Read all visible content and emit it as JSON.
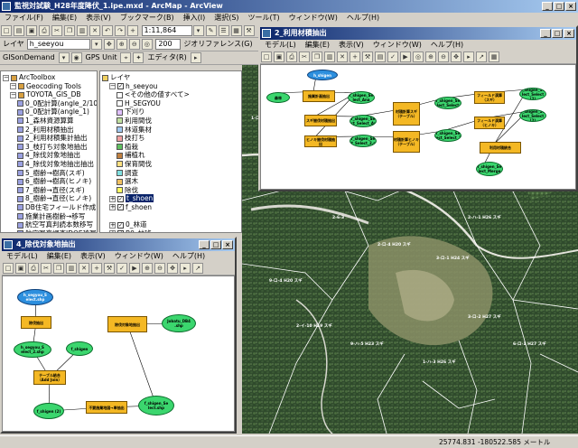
{
  "app": {
    "title": "監視対試験_H28年度降伏_1.ipe.mxd - ArcMap - ArcView"
  },
  "menu": [
    "ファイル(F)",
    "編集(E)",
    "表示(V)",
    "ブックマーク(B)",
    "挿入(I)",
    "選択(S)",
    "ツール(T)",
    "ウィンドウ(W)",
    "ヘルプ(H)"
  ],
  "toolbar1": {
    "scale_value": "1:11,864"
  },
  "toolbar2": {
    "layer_label": "レイヤ",
    "layer_value": "h_seeyou",
    "zoom_value": "200",
    "georef_label": "ジオリファレンス(G)"
  },
  "toolbar3": {
    "gisondemand": "GISonDemand",
    "gps_unit": "GPS Unit",
    "editor": "エディタ(R)"
  },
  "arctoolbox": {
    "items": [
      {
        "label": "ArcToolbox",
        "level": 0,
        "type": "root"
      },
      {
        "label": "Geocoding Tools",
        "level": 1,
        "type": "toolbox"
      },
      {
        "label": "TOYOTA_GIS_DB",
        "level": 1,
        "type": "toolbox"
      },
      {
        "label": "0_0配計算(angle_2/100)",
        "level": 2,
        "type": "tool"
      },
      {
        "label": "0_0配計算(angle_1)",
        "level": 2,
        "type": "tool"
      },
      {
        "label": "1_森林資源算算",
        "level": 2,
        "type": "tool"
      },
      {
        "label": "2_利用材積抽出",
        "level": 2,
        "type": "tool"
      },
      {
        "label": "2_利用材積集計抽出",
        "level": 2,
        "type": "tool"
      },
      {
        "label": "3_枝打ち対象地抽出",
        "level": 2,
        "type": "tool"
      },
      {
        "label": "4_除伐対象地抽出",
        "level": 2,
        "type": "tool"
      },
      {
        "label": "4_除伐対象地抽出抽出",
        "level": 2,
        "type": "tool"
      },
      {
        "label": "5_樹齢→樹高(スギ)",
        "level": 2,
        "type": "tool"
      },
      {
        "label": "6_樹齢→樹高(ヒノキ)",
        "level": 2,
        "type": "tool"
      },
      {
        "label": "7_樹齢→直径(スギ)",
        "level": 2,
        "type": "tool"
      },
      {
        "label": "8_樹齢→直径(ヒノキ)",
        "level": 2,
        "type": "tool"
      },
      {
        "label": "DB住宅フィールド作成",
        "level": 2,
        "type": "tool"
      },
      {
        "label": "施業計画樹齢→移写",
        "level": 2,
        "type": "tool"
      },
      {
        "label": "航空写真判読本数移写",
        "level": 2,
        "type": "tool"
      },
      {
        "label": "航空写真調査IDOE移写",
        "level": 2,
        "type": "tool"
      },
      {
        "label": "航空写真調査法移写",
        "level": 2,
        "type": "tool"
      },
      {
        "label": "カートグラフィ ツール",
        "level": 1,
        "type": "toolbox"
      },
      {
        "label": "サーバ ツール",
        "level": 1,
        "type": "toolbox"
      }
    ]
  },
  "toc": {
    "items": [
      {
        "label": "レイヤ",
        "level": 0,
        "type": "root"
      },
      {
        "label": "h_seeyou",
        "level": 1,
        "type": "layer",
        "checked": true
      },
      {
        "label": "<その他の値すべて>",
        "level": 2,
        "type": "legend",
        "color": "#ffffff"
      },
      {
        "label": "H_SEGYOU",
        "level": 2,
        "type": "legend",
        "color": "#ffffff"
      },
      {
        "label": "下刈り",
        "level": 2,
        "type": "legend",
        "color": "#e0c0ff"
      },
      {
        "label": "利用間伐",
        "level": 2,
        "type": "legend",
        "color": "#c0e0a0"
      },
      {
        "label": "林道集材",
        "level": 2,
        "type": "legend",
        "color": "#a0c8f0"
      },
      {
        "label": "枝打ち",
        "level": 2,
        "type": "legend",
        "color": "#f0a0a0"
      },
      {
        "label": "植栽",
        "level": 2,
        "type": "legend",
        "color": "#60c060"
      },
      {
        "label": "補植れ",
        "level": 2,
        "type": "legend",
        "color": "#c08040"
      },
      {
        "label": "保育間伐",
        "level": 2,
        "type": "legend",
        "color": "#ffe080"
      },
      {
        "label": "調査",
        "level": 2,
        "type": "legend",
        "color": "#80e0e0"
      },
      {
        "label": "選木",
        "level": 2,
        "type": "legend",
        "color": "#f0c060"
      },
      {
        "label": "除伐",
        "level": 2,
        "type": "legend",
        "color": "#ffff60"
      },
      {
        "label": "t_shoen",
        "level": 1,
        "type": "layer",
        "checked": true,
        "selected": true
      },
      {
        "label": "f_shoen",
        "level": 1,
        "type": "layer",
        "checked": true
      },
      {
        "label": "",
        "level": 1,
        "type": "gap"
      },
      {
        "label": "0_林道",
        "level": 1,
        "type": "layer",
        "checked": true
      },
      {
        "label": "B0_林班",
        "level": 1,
        "type": "layer",
        "checked": true
      },
      {
        "label": "B1_施業計画",
        "level": 1,
        "type": "layer",
        "checked": true
      },
      {
        "label": "H21年度作業実績",
        "level": 1,
        "type": "layer",
        "checked": true
      },
      {
        "label": "H20年度作業実績",
        "level": 1,
        "type": "layer",
        "checked": true
      }
    ]
  },
  "model1": {
    "title": "2_利用材積抽出",
    "menu": [
      "モデル(L)",
      "編集(E)",
      "表示(V)",
      "ウィンドウ(W)",
      "ヘルプ(H)"
    ],
    "nodes": [
      {
        "type": "blu",
        "label": "h_shigen"
      },
      {
        "type": "ell",
        "label": "森林"
      },
      {
        "type": "box",
        "label": "施業計画抽出"
      },
      {
        "type": "ell",
        "label": "f_shigen_Se lect_Ana"
      },
      {
        "type": "box",
        "label": "スギ間伐材積抽出"
      },
      {
        "type": "box",
        "label": "ヒノキ間伐材積抽出"
      },
      {
        "type": "ell",
        "label": "f_shigen_Se lect_Select_Ana"
      },
      {
        "type": "ell",
        "label": "f_shigen_Se lect_Select_2.shp"
      },
      {
        "type": "box",
        "label": "材積計算スギ（テーブル）"
      },
      {
        "type": "box",
        "label": "材積計算ヒノキ（テーブル）"
      },
      {
        "type": "ell",
        "label": "f_shigen_Se lect_Select"
      },
      {
        "type": "ell",
        "label": "f_shigen_Se lect_Select_2"
      },
      {
        "type": "box",
        "label": "フィールド演算（スギ）"
      },
      {
        "type": "box",
        "label": "フィールド演算（ヒノキ）"
      },
      {
        "type": "ell",
        "label": "f_shigen_Se lect_Select (2)"
      },
      {
        "type": "ell",
        "label": "f_shigen_Se lect_Select (2)"
      },
      {
        "type": "box",
        "label": "利用材積統合"
      },
      {
        "type": "ell",
        "label": "f_shigen_Se lect_Merge"
      }
    ]
  },
  "model2": {
    "title": "4_除伐対象地抽出",
    "menu": [
      "モデル(L)",
      "編集(E)",
      "表示(V)",
      "ウィンドウ(W)",
      "ヘルプ(H)"
    ],
    "nodes": [
      {
        "type": "blu",
        "label": "h_segyou_S elect.shp"
      },
      {
        "type": "box",
        "label": "除伐抽出"
      },
      {
        "type": "ell",
        "label": "h_segyou_S elect_2.shp"
      },
      {
        "type": "ell",
        "label": "f_shigen"
      },
      {
        "type": "box",
        "label": "テーブル結合（Add Join）"
      },
      {
        "type": "ell",
        "label": "f_shigen (2)"
      },
      {
        "type": "box",
        "label": "不要施業地図→単抽出"
      },
      {
        "type": "ell",
        "label": "f_shigen_Se lect.shp"
      },
      {
        "type": "box",
        "label": "除伐対象地抽出"
      },
      {
        "type": "ell",
        "label": "Jobatu_DB4 .shp"
      }
    ]
  },
  "map": {
    "labels": [
      "1-ロ-7 H27 スギ",
      "2-6-6 H25 スギ",
      "2-6-1 H27 スギ",
      "2-6-3",
      "5-ロ-1 H3 スギ",
      "2-ロ-3 H22 スギ",
      "2-ハ-1 H26 スギ",
      "2-ロ-4 H20 スギ",
      "3-ロ-1 H24 スギ",
      "9-ロ-4 H20 スギ",
      "9-ハ-5 H23 スギ",
      "2-イ-10 H19 スギ",
      "3-ロ-2 H27 スギ",
      "1-ハ-3 H26 スギ",
      "6-ロ-1 H27 スギ"
    ]
  },
  "status": {
    "coords": "25774.831  -180522.585 メートル"
  }
}
